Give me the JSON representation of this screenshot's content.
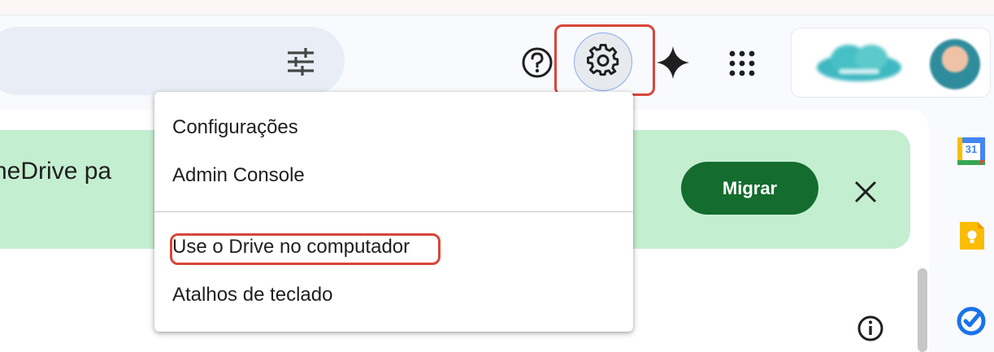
{
  "search": {
    "filter_icon": "tune-icon"
  },
  "header": {
    "help_icon": "help-circle-icon",
    "settings_icon": "gear-icon",
    "gemini_icon": "sparkle-icon",
    "apps_icon": "apps-grid-icon"
  },
  "banner": {
    "text": "neDrive pa",
    "button_label": "Migrar",
    "close_icon": "close-icon"
  },
  "settings_menu": {
    "items": [
      {
        "label": "Configurações"
      },
      {
        "label": "Admin Console"
      },
      {
        "label": "Use o Drive no computador"
      },
      {
        "label": "Atalhos de teclado"
      }
    ]
  },
  "side_panel": {
    "calendar_day": "31",
    "icons": [
      "calendar-icon",
      "keep-icon",
      "tasks-icon"
    ]
  },
  "colors": {
    "banner_bg": "#c4eed0",
    "primary_button": "#146c2e",
    "highlight": "#d7463a",
    "search_bg": "#e9eef6"
  }
}
